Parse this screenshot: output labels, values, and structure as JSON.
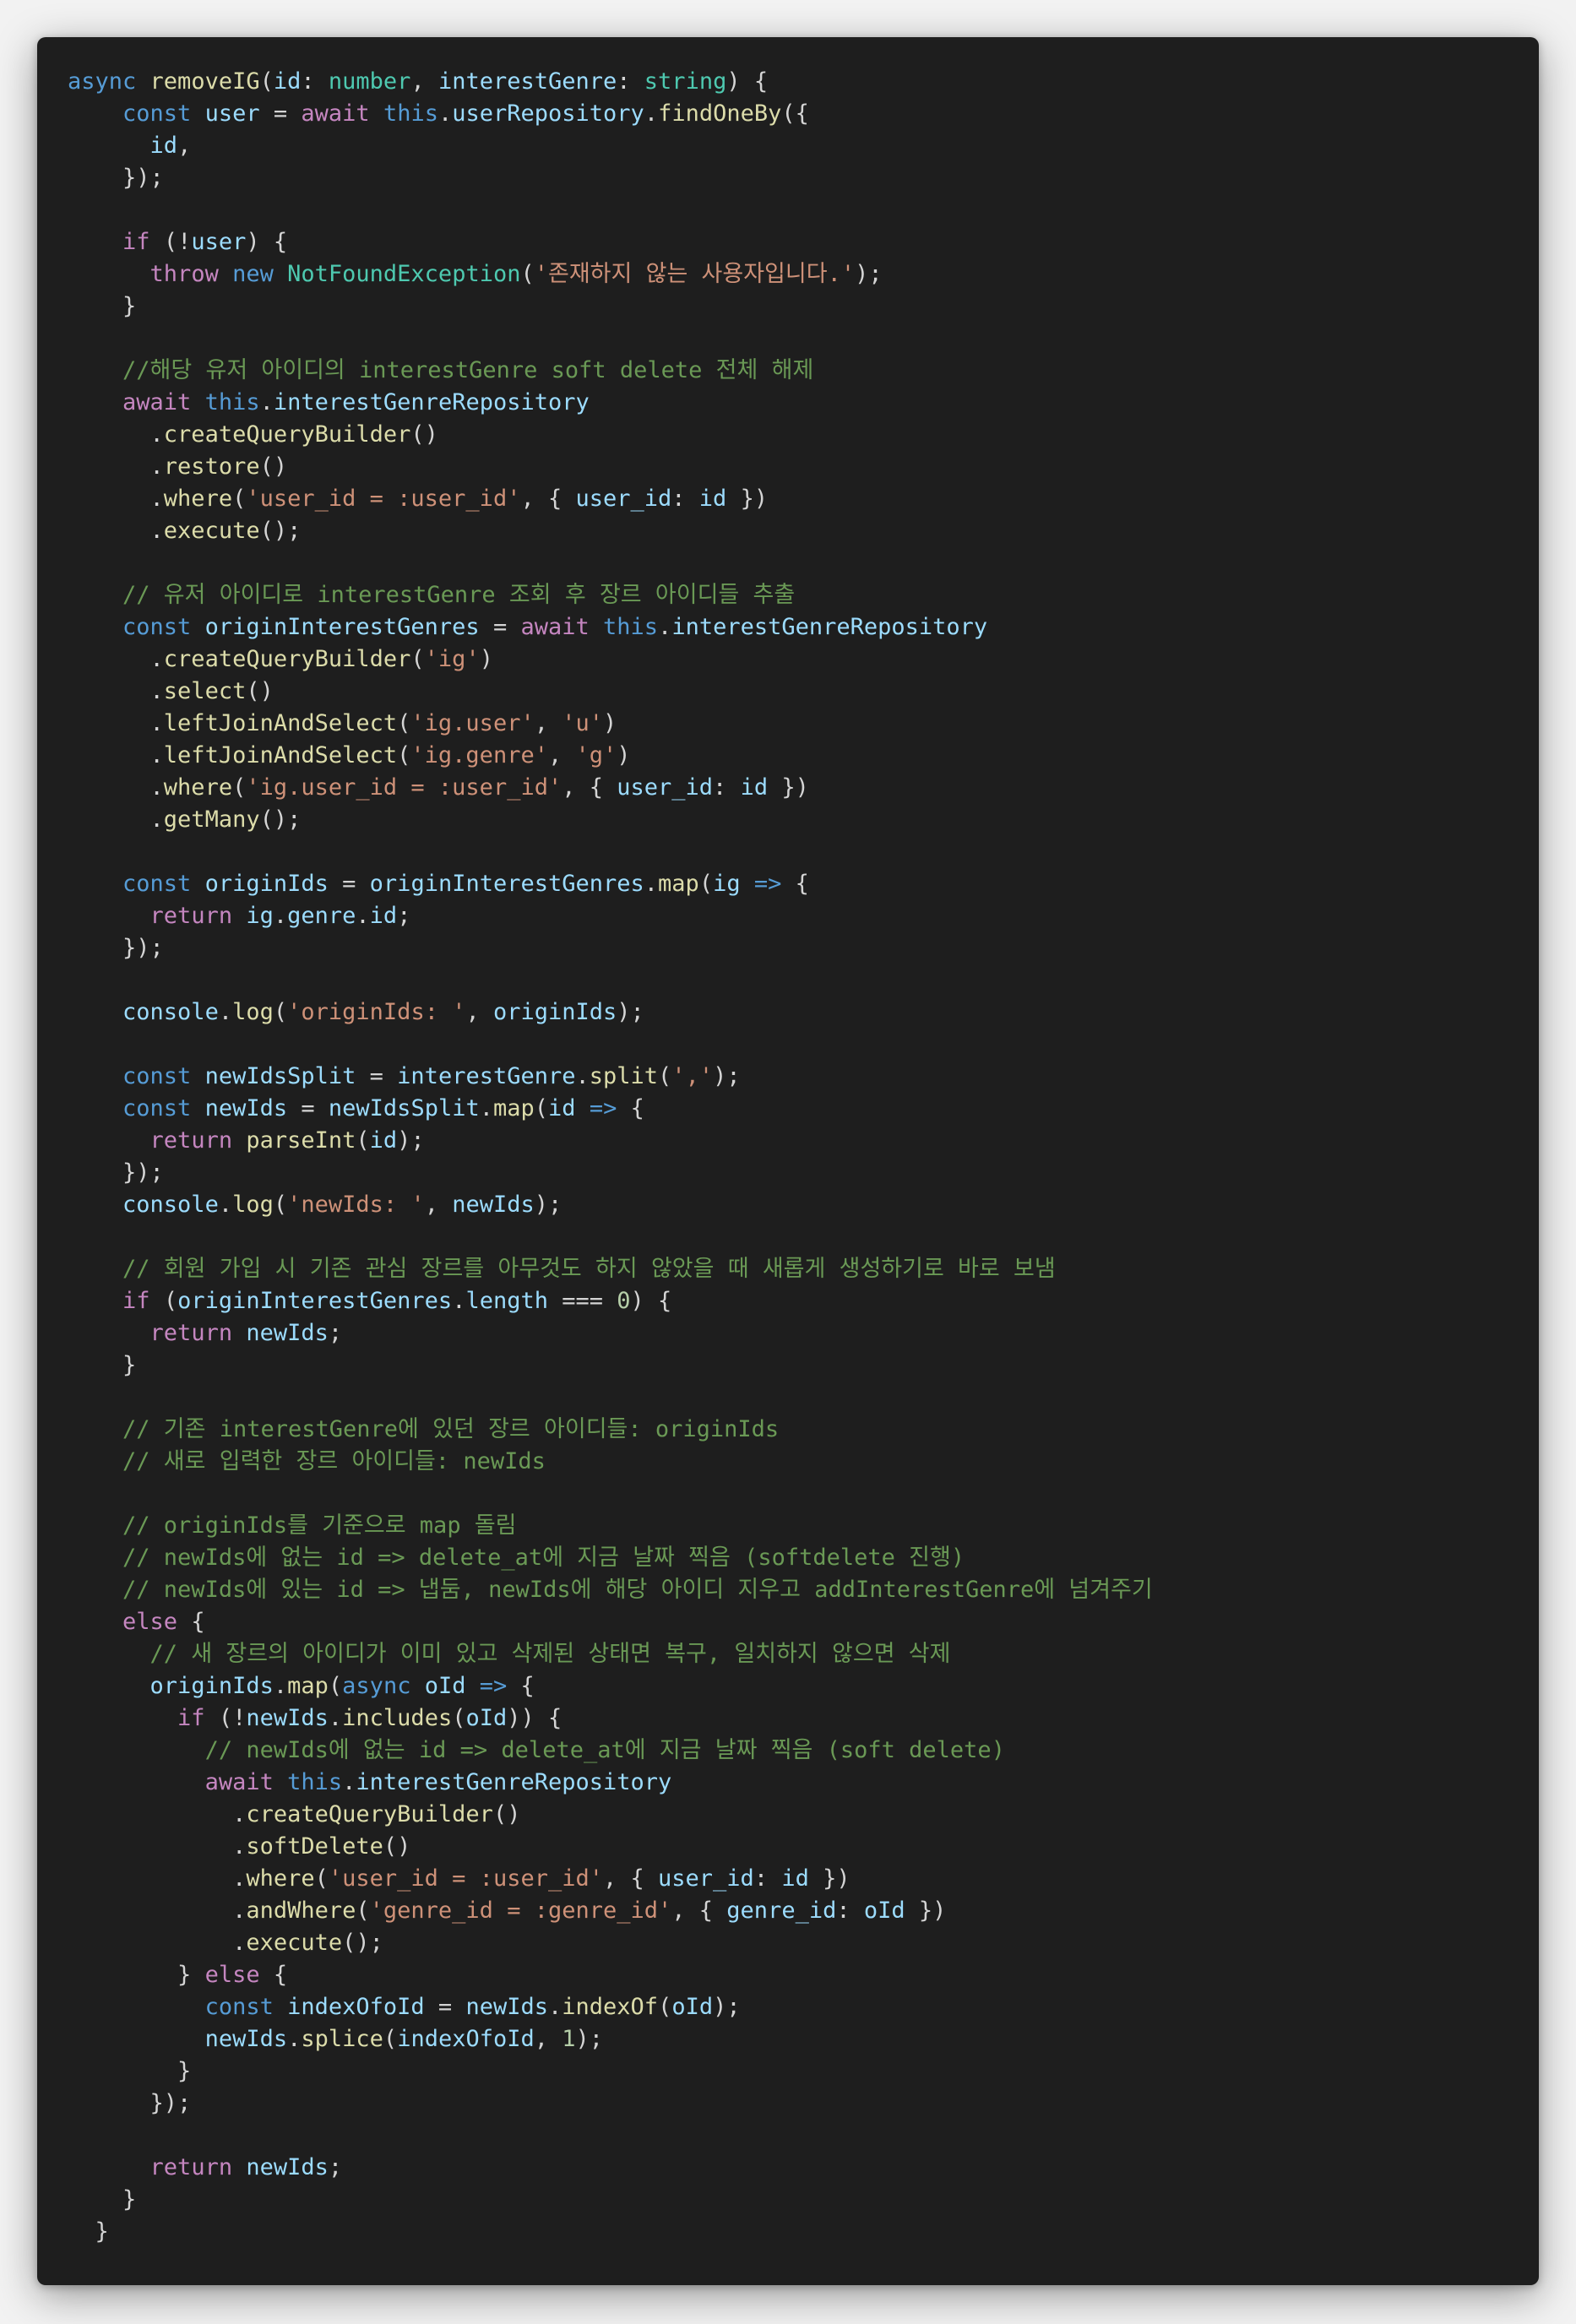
{
  "editor": {
    "theme_colors": {
      "background": "#1e1e1e",
      "page": "#f2f2f2",
      "keyword": "#569cd6",
      "control": "#c586c0",
      "function": "#dcdcaa",
      "variable": "#9cdcfe",
      "string": "#ce9178",
      "number": "#b5cea8",
      "comment": "#6a9955",
      "class": "#4ec9b0",
      "plain": "#d4d4d4"
    },
    "lines": [
      [
        [
          "kw",
          "async "
        ],
        [
          "fn",
          "removeIG"
        ],
        [
          "pl",
          "("
        ],
        [
          "var",
          "id"
        ],
        [
          "pl",
          ": "
        ],
        [
          "typ",
          "number"
        ],
        [
          "pl",
          ", "
        ],
        [
          "var",
          "interestGenre"
        ],
        [
          "pl",
          ": "
        ],
        [
          "typ",
          "string"
        ],
        [
          "pl",
          ") {"
        ]
      ],
      [
        [
          "pl",
          "    "
        ],
        [
          "kw",
          "const "
        ],
        [
          "var",
          "user"
        ],
        [
          "pl",
          " = "
        ],
        [
          "ctl",
          "await "
        ],
        [
          "kw",
          "this"
        ],
        [
          "pl",
          "."
        ],
        [
          "var",
          "userRepository"
        ],
        [
          "pl",
          "."
        ],
        [
          "fn",
          "findOneBy"
        ],
        [
          "pl",
          "({"
        ]
      ],
      [
        [
          "pl",
          "      "
        ],
        [
          "var",
          "id"
        ],
        [
          "pl",
          ","
        ]
      ],
      [
        [
          "pl",
          "    });"
        ]
      ],
      [],
      [
        [
          "pl",
          "    "
        ],
        [
          "ctl",
          "if "
        ],
        [
          "pl",
          "(!"
        ],
        [
          "var",
          "user"
        ],
        [
          "pl",
          ") {"
        ]
      ],
      [
        [
          "pl",
          "      "
        ],
        [
          "ctl",
          "throw "
        ],
        [
          "kw",
          "new "
        ],
        [
          "cls",
          "NotFoundException"
        ],
        [
          "pl",
          "("
        ],
        [
          "str",
          "'존재하지 않는 사용자입니다.'"
        ],
        [
          "pl",
          ");"
        ]
      ],
      [
        [
          "pl",
          "    }"
        ]
      ],
      [],
      [
        [
          "pl",
          "    "
        ],
        [
          "cmt",
          "//해당 유저 아이디의 interestGenre soft delete 전체 해제"
        ]
      ],
      [
        [
          "pl",
          "    "
        ],
        [
          "ctl",
          "await "
        ],
        [
          "kw",
          "this"
        ],
        [
          "pl",
          "."
        ],
        [
          "var",
          "interestGenreRepository"
        ]
      ],
      [
        [
          "pl",
          "      ."
        ],
        [
          "fn",
          "createQueryBuilder"
        ],
        [
          "pl",
          "()"
        ]
      ],
      [
        [
          "pl",
          "      ."
        ],
        [
          "fn",
          "restore"
        ],
        [
          "pl",
          "()"
        ]
      ],
      [
        [
          "pl",
          "      ."
        ],
        [
          "fn",
          "where"
        ],
        [
          "pl",
          "("
        ],
        [
          "str",
          "'user_id = :user_id'"
        ],
        [
          "pl",
          ", { "
        ],
        [
          "var",
          "user_id"
        ],
        [
          "pl",
          ": "
        ],
        [
          "var",
          "id"
        ],
        [
          "pl",
          " })"
        ]
      ],
      [
        [
          "pl",
          "      ."
        ],
        [
          "fn",
          "execute"
        ],
        [
          "pl",
          "();"
        ]
      ],
      [],
      [
        [
          "pl",
          "    "
        ],
        [
          "cmt",
          "// 유저 아이디로 interestGenre 조회 후 장르 아이디들 추출"
        ]
      ],
      [
        [
          "pl",
          "    "
        ],
        [
          "kw",
          "const "
        ],
        [
          "var",
          "originInterestGenres"
        ],
        [
          "pl",
          " = "
        ],
        [
          "ctl",
          "await "
        ],
        [
          "kw",
          "this"
        ],
        [
          "pl",
          "."
        ],
        [
          "var",
          "interestGenreRepository"
        ]
      ],
      [
        [
          "pl",
          "      ."
        ],
        [
          "fn",
          "createQueryBuilder"
        ],
        [
          "pl",
          "("
        ],
        [
          "str",
          "'ig'"
        ],
        [
          "pl",
          ")"
        ]
      ],
      [
        [
          "pl",
          "      ."
        ],
        [
          "fn",
          "select"
        ],
        [
          "pl",
          "()"
        ]
      ],
      [
        [
          "pl",
          "      ."
        ],
        [
          "fn",
          "leftJoinAndSelect"
        ],
        [
          "pl",
          "("
        ],
        [
          "str",
          "'ig.user'"
        ],
        [
          "pl",
          ", "
        ],
        [
          "str",
          "'u'"
        ],
        [
          "pl",
          ")"
        ]
      ],
      [
        [
          "pl",
          "      ."
        ],
        [
          "fn",
          "leftJoinAndSelect"
        ],
        [
          "pl",
          "("
        ],
        [
          "str",
          "'ig.genre'"
        ],
        [
          "pl",
          ", "
        ],
        [
          "str",
          "'g'"
        ],
        [
          "pl",
          ")"
        ]
      ],
      [
        [
          "pl",
          "      ."
        ],
        [
          "fn",
          "where"
        ],
        [
          "pl",
          "("
        ],
        [
          "str",
          "'ig.user_id = :user_id'"
        ],
        [
          "pl",
          ", { "
        ],
        [
          "var",
          "user_id"
        ],
        [
          "pl",
          ": "
        ],
        [
          "var",
          "id"
        ],
        [
          "pl",
          " })"
        ]
      ],
      [
        [
          "pl",
          "      ."
        ],
        [
          "fn",
          "getMany"
        ],
        [
          "pl",
          "();"
        ]
      ],
      [],
      [
        [
          "pl",
          "    "
        ],
        [
          "kw",
          "const "
        ],
        [
          "var",
          "originIds"
        ],
        [
          "pl",
          " = "
        ],
        [
          "var",
          "originInterestGenres"
        ],
        [
          "pl",
          "."
        ],
        [
          "fn",
          "map"
        ],
        [
          "pl",
          "("
        ],
        [
          "var",
          "ig"
        ],
        [
          "pl",
          " "
        ],
        [
          "kw",
          "=>"
        ],
        [
          "pl",
          " {"
        ]
      ],
      [
        [
          "pl",
          "      "
        ],
        [
          "ctl",
          "return "
        ],
        [
          "var",
          "ig"
        ],
        [
          "pl",
          "."
        ],
        [
          "var",
          "genre"
        ],
        [
          "pl",
          "."
        ],
        [
          "var",
          "id"
        ],
        [
          "pl",
          ";"
        ]
      ],
      [
        [
          "pl",
          "    });"
        ]
      ],
      [],
      [
        [
          "pl",
          "    "
        ],
        [
          "var",
          "console"
        ],
        [
          "pl",
          "."
        ],
        [
          "fn",
          "log"
        ],
        [
          "pl",
          "("
        ],
        [
          "str",
          "'originIds: '"
        ],
        [
          "pl",
          ", "
        ],
        [
          "var",
          "originIds"
        ],
        [
          "pl",
          ");"
        ]
      ],
      [],
      [
        [
          "pl",
          "    "
        ],
        [
          "kw",
          "const "
        ],
        [
          "var",
          "newIdsSplit"
        ],
        [
          "pl",
          " = "
        ],
        [
          "var",
          "interestGenre"
        ],
        [
          "pl",
          "."
        ],
        [
          "fn",
          "split"
        ],
        [
          "pl",
          "("
        ],
        [
          "str",
          "','"
        ],
        [
          "pl",
          ");"
        ]
      ],
      [
        [
          "pl",
          "    "
        ],
        [
          "kw",
          "const "
        ],
        [
          "var",
          "newIds"
        ],
        [
          "pl",
          " = "
        ],
        [
          "var",
          "newIdsSplit"
        ],
        [
          "pl",
          "."
        ],
        [
          "fn",
          "map"
        ],
        [
          "pl",
          "("
        ],
        [
          "var",
          "id"
        ],
        [
          "pl",
          " "
        ],
        [
          "kw",
          "=>"
        ],
        [
          "pl",
          " {"
        ]
      ],
      [
        [
          "pl",
          "      "
        ],
        [
          "ctl",
          "return "
        ],
        [
          "fn",
          "parseInt"
        ],
        [
          "pl",
          "("
        ],
        [
          "var",
          "id"
        ],
        [
          "pl",
          ");"
        ]
      ],
      [
        [
          "pl",
          "    });"
        ]
      ],
      [
        [
          "pl",
          "    "
        ],
        [
          "var",
          "console"
        ],
        [
          "pl",
          "."
        ],
        [
          "fn",
          "log"
        ],
        [
          "pl",
          "("
        ],
        [
          "str",
          "'newIds: '"
        ],
        [
          "pl",
          ", "
        ],
        [
          "var",
          "newIds"
        ],
        [
          "pl",
          ");"
        ]
      ],
      [],
      [
        [
          "pl",
          "    "
        ],
        [
          "cmt",
          "// 회원 가입 시 기존 관심 장르를 아무것도 하지 않았을 때 새롭게 생성하기로 바로 보냄"
        ]
      ],
      [
        [
          "pl",
          "    "
        ],
        [
          "ctl",
          "if "
        ],
        [
          "pl",
          "("
        ],
        [
          "var",
          "originInterestGenres"
        ],
        [
          "pl",
          "."
        ],
        [
          "var",
          "length"
        ],
        [
          "pl",
          " === "
        ],
        [
          "num",
          "0"
        ],
        [
          "pl",
          ") {"
        ]
      ],
      [
        [
          "pl",
          "      "
        ],
        [
          "ctl",
          "return "
        ],
        [
          "var",
          "newIds"
        ],
        [
          "pl",
          ";"
        ]
      ],
      [
        [
          "pl",
          "    }"
        ]
      ],
      [],
      [
        [
          "pl",
          "    "
        ],
        [
          "cmt",
          "// 기존 interestGenre에 있던 장르 아이디들: originIds"
        ]
      ],
      [
        [
          "pl",
          "    "
        ],
        [
          "cmt",
          "// 새로 입력한 장르 아이디들: newIds"
        ]
      ],
      [],
      [
        [
          "pl",
          "    "
        ],
        [
          "cmt",
          "// originIds를 기준으로 map 돌림"
        ]
      ],
      [
        [
          "pl",
          "    "
        ],
        [
          "cmt",
          "// newIds에 없는 id => delete_at에 지금 날짜 찍음 (softdelete 진행)"
        ]
      ],
      [
        [
          "pl",
          "    "
        ],
        [
          "cmt",
          "// newIds에 있는 id => 냅둠, newIds에 해당 아이디 지우고 addInterestGenre에 넘겨주기"
        ]
      ],
      [
        [
          "pl",
          "    "
        ],
        [
          "ctl",
          "else "
        ],
        [
          "pl",
          "{"
        ]
      ],
      [
        [
          "pl",
          "      "
        ],
        [
          "cmt",
          "// 새 장르의 아이디가 이미 있고 삭제된 상태면 복구, 일치하지 않으면 삭제"
        ]
      ],
      [
        [
          "pl",
          "      "
        ],
        [
          "var",
          "originIds"
        ],
        [
          "pl",
          "."
        ],
        [
          "fn",
          "map"
        ],
        [
          "pl",
          "("
        ],
        [
          "kw",
          "async "
        ],
        [
          "var",
          "oId"
        ],
        [
          "pl",
          " "
        ],
        [
          "kw",
          "=>"
        ],
        [
          "pl",
          " {"
        ]
      ],
      [
        [
          "pl",
          "        "
        ],
        [
          "ctl",
          "if "
        ],
        [
          "pl",
          "(!"
        ],
        [
          "var",
          "newIds"
        ],
        [
          "pl",
          "."
        ],
        [
          "fn",
          "includes"
        ],
        [
          "pl",
          "("
        ],
        [
          "var",
          "oId"
        ],
        [
          "pl",
          ")) {"
        ]
      ],
      [
        [
          "pl",
          "          "
        ],
        [
          "cmt",
          "// newIds에 없는 id => delete_at에 지금 날짜 찍음 (soft delete)"
        ]
      ],
      [
        [
          "pl",
          "          "
        ],
        [
          "ctl",
          "await "
        ],
        [
          "kw",
          "this"
        ],
        [
          "pl",
          "."
        ],
        [
          "var",
          "interestGenreRepository"
        ]
      ],
      [
        [
          "pl",
          "            ."
        ],
        [
          "fn",
          "createQueryBuilder"
        ],
        [
          "pl",
          "()"
        ]
      ],
      [
        [
          "pl",
          "            ."
        ],
        [
          "fn",
          "softDelete"
        ],
        [
          "pl",
          "()"
        ]
      ],
      [
        [
          "pl",
          "            ."
        ],
        [
          "fn",
          "where"
        ],
        [
          "pl",
          "("
        ],
        [
          "str",
          "'user_id = :user_id'"
        ],
        [
          "pl",
          ", { "
        ],
        [
          "var",
          "user_id"
        ],
        [
          "pl",
          ": "
        ],
        [
          "var",
          "id"
        ],
        [
          "pl",
          " })"
        ]
      ],
      [
        [
          "pl",
          "            ."
        ],
        [
          "fn",
          "andWhere"
        ],
        [
          "pl",
          "("
        ],
        [
          "str",
          "'genre_id = :genre_id'"
        ],
        [
          "pl",
          ", { "
        ],
        [
          "var",
          "genre_id"
        ],
        [
          "pl",
          ": "
        ],
        [
          "var",
          "oId"
        ],
        [
          "pl",
          " })"
        ]
      ],
      [
        [
          "pl",
          "            ."
        ],
        [
          "fn",
          "execute"
        ],
        [
          "pl",
          "();"
        ]
      ],
      [
        [
          "pl",
          "        } "
        ],
        [
          "ctl",
          "else "
        ],
        [
          "pl",
          "{"
        ]
      ],
      [
        [
          "pl",
          "          "
        ],
        [
          "kw",
          "const "
        ],
        [
          "var",
          "indexOfoId"
        ],
        [
          "pl",
          " = "
        ],
        [
          "var",
          "newIds"
        ],
        [
          "pl",
          "."
        ],
        [
          "fn",
          "indexOf"
        ],
        [
          "pl",
          "("
        ],
        [
          "var",
          "oId"
        ],
        [
          "pl",
          ");"
        ]
      ],
      [
        [
          "pl",
          "          "
        ],
        [
          "var",
          "newIds"
        ],
        [
          "pl",
          "."
        ],
        [
          "fn",
          "splice"
        ],
        [
          "pl",
          "("
        ],
        [
          "var",
          "indexOfoId"
        ],
        [
          "pl",
          ", "
        ],
        [
          "num",
          "1"
        ],
        [
          "pl",
          ");"
        ]
      ],
      [
        [
          "pl",
          "        }"
        ]
      ],
      [
        [
          "pl",
          "      });"
        ]
      ],
      [],
      [
        [
          "pl",
          "      "
        ],
        [
          "ctl",
          "return "
        ],
        [
          "var",
          "newIds"
        ],
        [
          "pl",
          ";"
        ]
      ],
      [
        [
          "pl",
          "    }"
        ]
      ],
      [
        [
          "pl",
          "  }"
        ]
      ]
    ]
  }
}
